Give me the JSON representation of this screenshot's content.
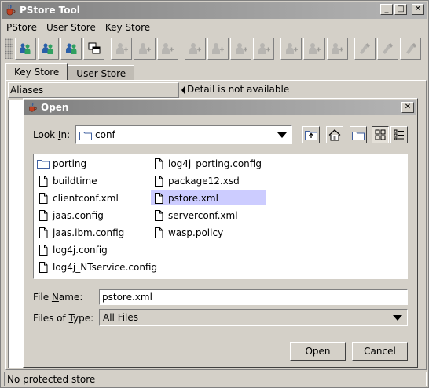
{
  "window": {
    "title": "PStore Tool"
  },
  "menu": [
    {
      "label": "PStore"
    },
    {
      "label": "User Store"
    },
    {
      "label": "Key Store"
    }
  ],
  "toolbar": {
    "buttons": [
      {
        "icon": "open-store-icon",
        "enabled": true
      },
      {
        "icon": "users-icon",
        "enabled": true
      },
      {
        "icon": "user-group-icon",
        "enabled": true
      },
      {
        "icon": "windows-icon",
        "enabled": true
      },
      {
        "icon": "add-user-icon",
        "enabled": false
      },
      {
        "icon": "user-group-icon",
        "enabled": false
      },
      {
        "icon": "user-properties-icon",
        "enabled": false
      },
      {
        "icon": "import-user-icon",
        "enabled": false
      },
      {
        "icon": "remove-user-icon",
        "enabled": false
      },
      {
        "icon": "swap-user-icon",
        "enabled": false
      },
      {
        "icon": "user-arrow-icon",
        "enabled": false
      },
      {
        "icon": "add-member-icon",
        "enabled": false
      },
      {
        "icon": "remove-member-icon",
        "enabled": false
      },
      {
        "icon": "swap-member-icon",
        "enabled": false
      },
      {
        "icon": "add-key-icon",
        "enabled": false
      },
      {
        "icon": "remove-key-icon",
        "enabled": false
      },
      {
        "icon": "edit-key-icon",
        "enabled": false
      }
    ]
  },
  "tabs": [
    {
      "label": "Key Store",
      "active": true
    },
    {
      "label": "User Store",
      "active": false
    }
  ],
  "panel": {
    "aliases_header": "Aliases",
    "detail_text": "Detail is not available"
  },
  "status": {
    "text": "No protected store"
  },
  "dialog": {
    "title": "Open",
    "look_in_label_pre": "Look ",
    "look_in_label_mnemonic": "I",
    "look_in_label_post": "n:",
    "look_in_value": "conf",
    "files": [
      {
        "name": "porting",
        "type": "folder",
        "selected": false
      },
      {
        "name": "buildtime",
        "type": "file",
        "selected": false
      },
      {
        "name": "clientconf.xml",
        "type": "file",
        "selected": false
      },
      {
        "name": "jaas.config",
        "type": "file",
        "selected": false
      },
      {
        "name": "jaas.ibm.config",
        "type": "file",
        "selected": false
      },
      {
        "name": "log4j.config",
        "type": "file",
        "selected": false
      },
      {
        "name": "log4j_NTservice.config",
        "type": "file",
        "selected": false
      },
      {
        "name": "log4j_porting.config",
        "type": "file",
        "selected": false
      },
      {
        "name": "package12.xsd",
        "type": "file",
        "selected": false
      },
      {
        "name": "pstore.xml",
        "type": "file",
        "selected": true
      },
      {
        "name": "serverconf.xml",
        "type": "file",
        "selected": false
      },
      {
        "name": "wasp.policy",
        "type": "file",
        "selected": false
      }
    ],
    "file_name_label_pre": "File ",
    "file_name_label_mnemonic": "N",
    "file_name_label_post": "ame:",
    "file_name_value": "pstore.xml",
    "file_type_label_pre": "Files of ",
    "file_type_label_mnemonic": "T",
    "file_type_label_post": "ype:",
    "file_type_value": "All Files",
    "open_label": "Open",
    "cancel_label": "Cancel"
  }
}
